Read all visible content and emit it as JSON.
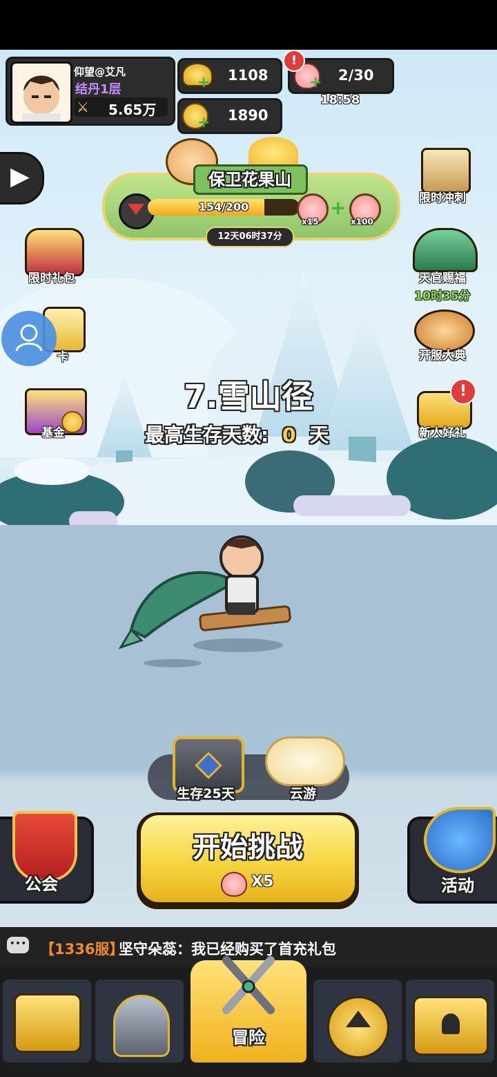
{
  "player": {
    "name": "仰望@艾凡",
    "realm": "结丹1层",
    "power": "5.65万"
  },
  "currency": {
    "gold": "1108",
    "coins": "1890",
    "stamina": "2/30",
    "stamina_timer": "18:58"
  },
  "event": {
    "title": "保卫花果山",
    "progress_text": "154/200",
    "progress_value": 0.77,
    "reward1_count": "x15",
    "reward2_count": "x100",
    "countdown": "12天06时37分"
  },
  "left_menu": {
    "limited_gift": "限时礼包",
    "card": "卡",
    "fund": "基金"
  },
  "right_menu": {
    "limited_sprint": "限时冲刺",
    "tianguan": "天官赐福",
    "tianguan_timer": "10时35分",
    "server_open": "开服大典",
    "newbie_gift": "新人好礼"
  },
  "stage": {
    "name": "7.雪山径",
    "best_label": "最高生存天数:",
    "best_value": "0",
    "best_unit": "天"
  },
  "bottom_actions": {
    "survive_chest": "生存25天",
    "cloud_travel": "云游",
    "guild": "公会",
    "start": "开始挑战",
    "cost": "X5",
    "activity": "活动"
  },
  "chat": {
    "server": "【1336服】",
    "message": "坚守朵蕊：我已经购买了首充礼包"
  },
  "nav": {
    "adventure": "冒险"
  },
  "colors": {
    "accent_gold": "#f6d34a",
    "realm_purple": "#c58bff",
    "timer_green": "#8ee04a",
    "alert_red": "#e33a3a"
  }
}
